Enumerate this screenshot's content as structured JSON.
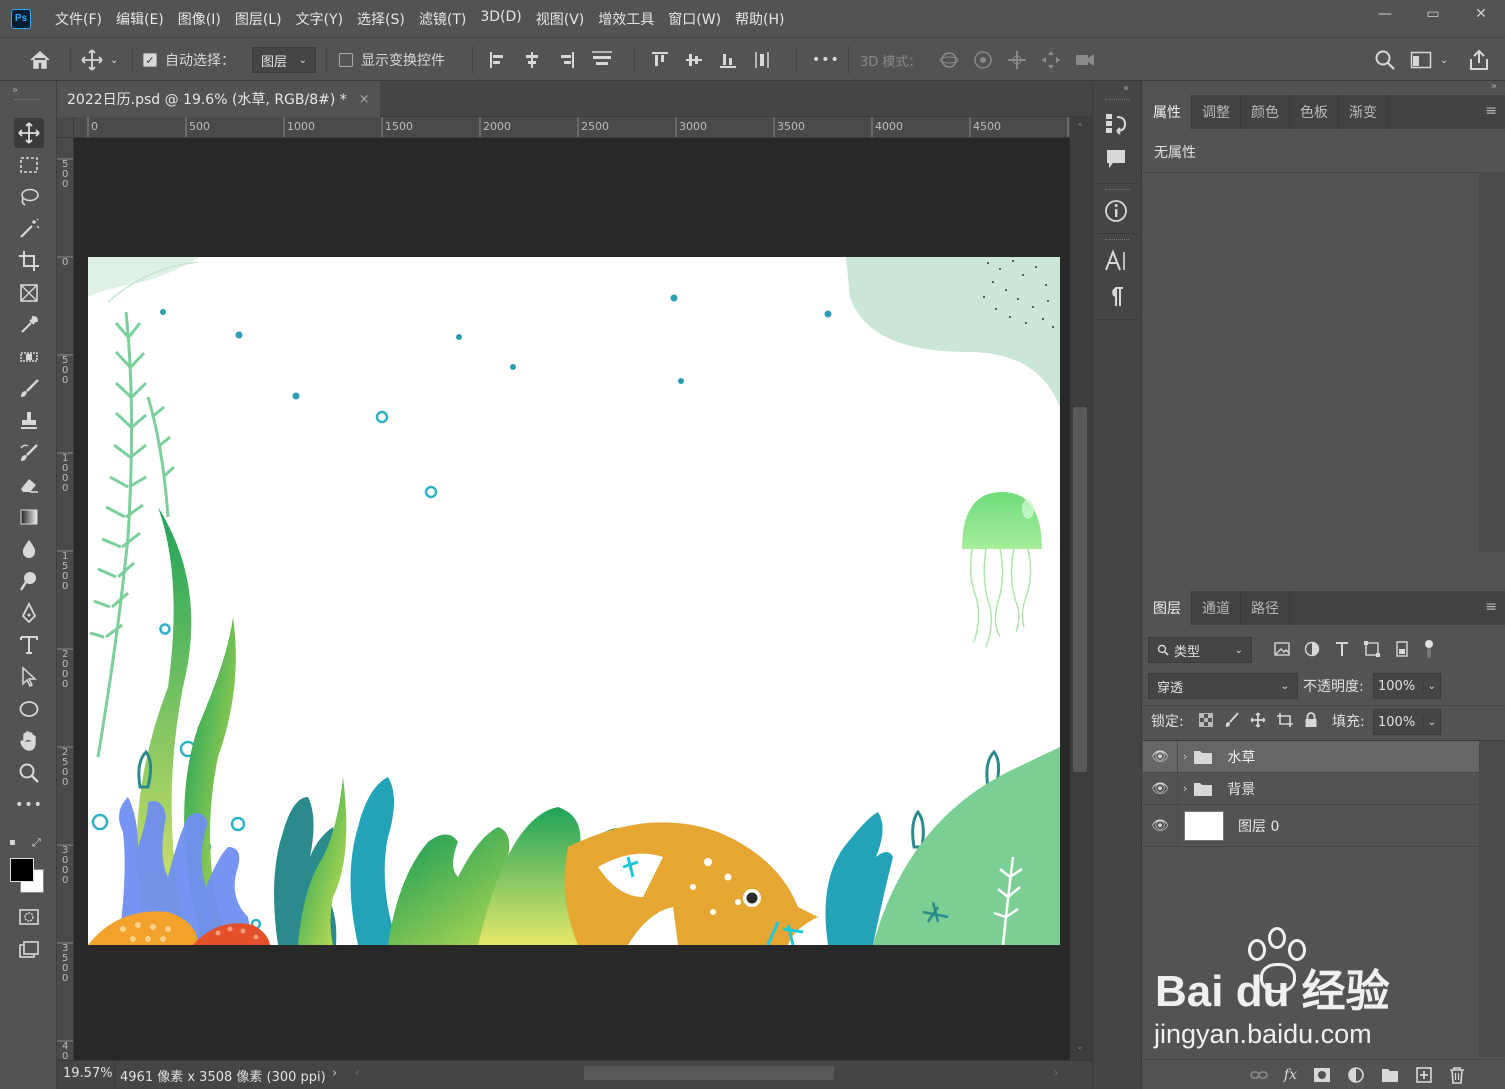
{
  "app": {
    "logo": "Ps"
  },
  "menu": [
    "文件(F)",
    "编辑(E)",
    "图像(I)",
    "图层(L)",
    "文字(Y)",
    "选择(S)",
    "滤镜(T)",
    "3D(D)",
    "视图(V)",
    "增效工具",
    "窗口(W)",
    "帮助(H)"
  ],
  "window_controls": {
    "minimize": "—",
    "restore": "▭",
    "close": "✕"
  },
  "options": {
    "auto_select_label": "自动选择：",
    "auto_select_checked": "✓",
    "auto_select_target": "图层",
    "show_transform_label": "显示变换控件",
    "more": "•••",
    "mode_3d_label": "3D 模式："
  },
  "document": {
    "tab_title": "2022日历.psd @ 19.6% (水草, RGB/8#) *",
    "close": "×"
  },
  "ruler": {
    "top_ticks": [
      "0",
      "500",
      "1000",
      "1500",
      "2000",
      "2500",
      "3000",
      "3500",
      "4000",
      "4500"
    ],
    "left_ticks": [
      "5\n0\n0",
      "0",
      "5\n0\n0",
      "1\n0\n0\n0",
      "1\n5\n0\n0",
      "2\n0\n0\n0",
      "2\n5\n0\n0",
      "3\n0\n0\n0",
      "3\n5\n0\n0",
      "4\n0"
    ]
  },
  "status": {
    "zoom": "19.57%",
    "info": "4961 像素 x 3508 像素 (300 ppi)",
    "arrow": "›"
  },
  "properties_panel": {
    "tabs": [
      "属性",
      "调整",
      "颜色",
      "色板",
      "渐变"
    ],
    "content": "无属性"
  },
  "layers_panel": {
    "tabs": [
      "图层",
      "通道",
      "路径"
    ],
    "filter_label": "类型",
    "blend_mode": "穿透",
    "opacity_label": "不透明度:",
    "opacity_value": "100%",
    "lock_label": "锁定:",
    "fill_label": "填充:",
    "fill_value": "100%",
    "layers": [
      {
        "name": "水草",
        "type": "group",
        "selected": true
      },
      {
        "name": "背景",
        "type": "group",
        "selected": false
      },
      {
        "name": "图层 0",
        "type": "layer",
        "selected": false
      }
    ],
    "footer_icons": [
      "link-icon",
      "fx-icon",
      "mask-icon",
      "adjustment-icon",
      "folder-icon",
      "new-layer-icon",
      "trash-icon"
    ],
    "fx_label": "fx"
  },
  "watermark": {
    "brand": "Bai du 经验",
    "url": "jingyan.baidu.com"
  },
  "colors": {
    "accent": "#31a8ff",
    "canvas_bg": "#282828",
    "panel_bg": "#535353"
  }
}
